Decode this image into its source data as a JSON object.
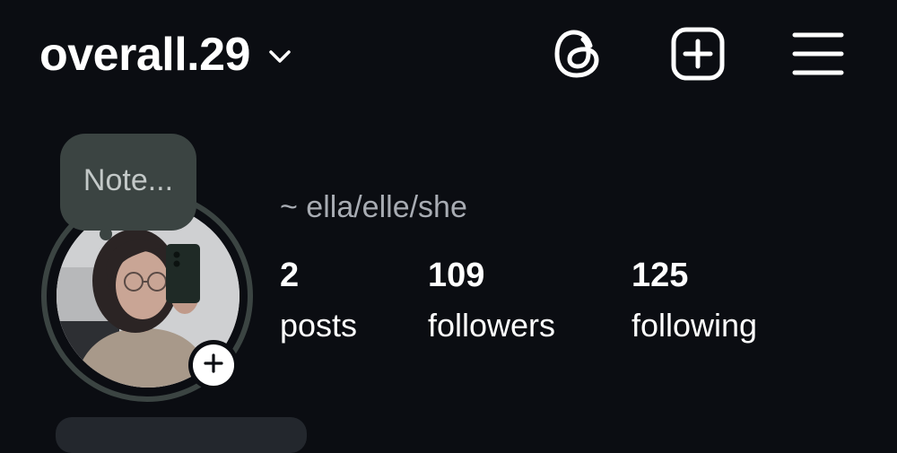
{
  "header": {
    "username": "overall.29",
    "icons": {
      "account_switcher": "chevron-down-icon",
      "threads": "threads-icon",
      "create": "plus-square-icon",
      "menu": "hamburger-menu-icon"
    }
  },
  "profile": {
    "note_placeholder": "Note...",
    "pronouns": "~ ella/elle/she",
    "add_story_icon": "plus-icon"
  },
  "stats": {
    "posts": {
      "value": "2",
      "label": "posts"
    },
    "followers": {
      "value": "109",
      "label": "followers"
    },
    "following": {
      "value": "125",
      "label": "following"
    }
  },
  "colors": {
    "background": "#0b0d12",
    "note_bubble": "#3b4442",
    "muted_text": "#a8acb3"
  }
}
